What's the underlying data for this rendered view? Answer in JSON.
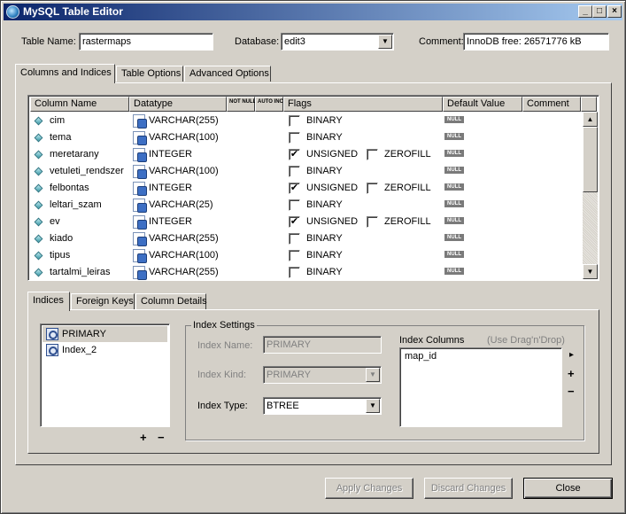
{
  "window": {
    "title": "MySQL Table Editor"
  },
  "titlebar_buttons": {
    "minimize": "_",
    "maximize": "□",
    "close": "×"
  },
  "form": {
    "table_name_label": "Table Name:",
    "table_name_value": "rastermaps",
    "database_label": "Database:",
    "database_value": "edit3",
    "comment_label": "Comment:",
    "comment_value": "InnoDB free: 26571776 kB"
  },
  "main_tabs": [
    "Columns and Indices",
    "Table Options",
    "Advanced Options"
  ],
  "grid": {
    "headers": {
      "column_name": "Column Name",
      "datatype": "Datatype",
      "not_null": "NOT NULL",
      "auto_inc": "AUTO INC",
      "flags": "Flags",
      "default_value": "Default Value",
      "comment": "Comment"
    },
    "null_badge": "NULL",
    "rows": [
      {
        "name": "cim",
        "type": "VARCHAR(255)",
        "flag1": "BINARY",
        "flag1_checked": false,
        "flag2": ""
      },
      {
        "name": "tema",
        "type": "VARCHAR(100)",
        "flag1": "BINARY",
        "flag1_checked": false,
        "flag2": ""
      },
      {
        "name": "meretarany",
        "type": "INTEGER",
        "flag1": "UNSIGNED",
        "flag1_checked": true,
        "flag2": "ZEROFILL"
      },
      {
        "name": "vetuleti_rendszer",
        "type": "VARCHAR(100)",
        "flag1": "BINARY",
        "flag1_checked": false,
        "flag2": ""
      },
      {
        "name": "felbontas",
        "type": "INTEGER",
        "flag1": "UNSIGNED",
        "flag1_checked": true,
        "flag2": "ZEROFILL"
      },
      {
        "name": "leltari_szam",
        "type": "VARCHAR(25)",
        "flag1": "BINARY",
        "flag1_checked": false,
        "flag2": ""
      },
      {
        "name": "ev",
        "type": "INTEGER",
        "flag1": "UNSIGNED",
        "flag1_checked": true,
        "flag2": "ZEROFILL"
      },
      {
        "name": "kiado",
        "type": "VARCHAR(255)",
        "flag1": "BINARY",
        "flag1_checked": false,
        "flag2": ""
      },
      {
        "name": "tipus",
        "type": "VARCHAR(100)",
        "flag1": "BINARY",
        "flag1_checked": false,
        "flag2": ""
      },
      {
        "name": "tartalmi_leiras",
        "type": "VARCHAR(255)",
        "flag1": "BINARY",
        "flag1_checked": false,
        "flag2": ""
      }
    ]
  },
  "sub_tabs": [
    "Indices",
    "Foreign Keys",
    "Column Details"
  ],
  "indices": {
    "list": [
      "PRIMARY",
      "Index_2"
    ],
    "add_symbol": "+",
    "remove_symbol": "−"
  },
  "index_settings": {
    "group_title": "Index Settings",
    "name_label": "Index Name:",
    "name_value": "PRIMARY",
    "kind_label": "Index Kind:",
    "kind_value": "PRIMARY",
    "type_label": "Index Type:",
    "type_value": "BTREE",
    "columns_label": "Index Columns",
    "columns_hint": "(Use Drag'n'Drop)",
    "columns": [
      "map_id"
    ],
    "arrow_symbol": "▸",
    "add_symbol": "+",
    "remove_symbol": "−"
  },
  "buttons": {
    "apply": "Apply Changes",
    "discard": "Discard Changes",
    "close": "Close"
  }
}
